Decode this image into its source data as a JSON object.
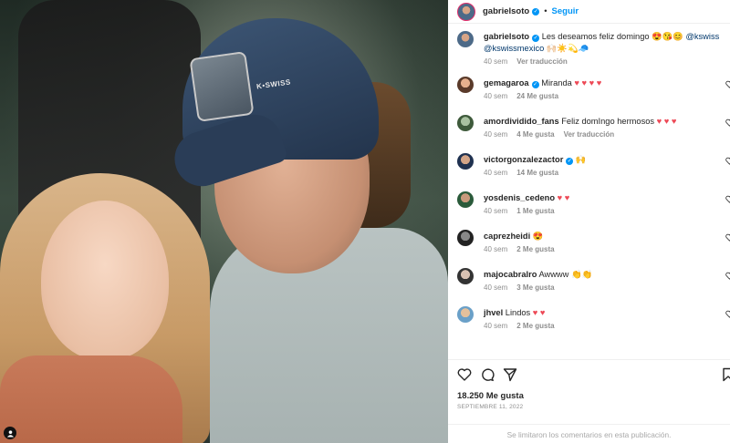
{
  "photo": {
    "brand_text": "K•SWISS"
  },
  "header": {
    "username": "gabrielsoto",
    "follow_label": "Seguir"
  },
  "caption": {
    "username": "gabrielsoto",
    "text_1": "Les deseamos feliz domingo 😍😘😊",
    "mention_1": "@kswiss",
    "mention_2": "@kswissmexico",
    "text_2": "🙌🏻☀️💫🧢",
    "time": "40 sem",
    "translate": "Ver traducción"
  },
  "comments": [
    {
      "username": "gemagaroa",
      "verified": true,
      "text": "Miranda",
      "hearts": "♥ ♥ ♥ ♥",
      "time": "40 sem",
      "likes": "24 Me gusta",
      "translate": ""
    },
    {
      "username": "amordividido_fans",
      "verified": false,
      "text": "Feliz domIngo hermosos",
      "hearts": "♥ ♥ ♥",
      "time": "40 sem",
      "likes": "4 Me gusta",
      "translate": "Ver traducción"
    },
    {
      "username": "victorgonzalezactor",
      "verified": true,
      "text": "🙌",
      "hearts": "",
      "time": "40 sem",
      "likes": "14 Me gusta",
      "translate": ""
    },
    {
      "username": "yosdenis_cedeno",
      "verified": false,
      "text": "",
      "hearts": "♥ ♥",
      "time": "40 sem",
      "likes": "1 Me gusta",
      "translate": ""
    },
    {
      "username": "caprezheidi",
      "verified": false,
      "text": "😍",
      "hearts": "",
      "time": "40 sem",
      "likes": "2 Me gusta",
      "translate": ""
    },
    {
      "username": "majocabralro",
      "verified": false,
      "text": "Awwww 👏👏",
      "hearts": "",
      "time": "40 sem",
      "likes": "3 Me gusta",
      "translate": ""
    },
    {
      "username": "jhvel",
      "verified": false,
      "text": "Lindos",
      "hearts": "♥ ♥",
      "time": "40 sem",
      "likes": "2 Me gusta",
      "translate": ""
    }
  ],
  "footer": {
    "likes": "18.250 Me gusta",
    "date": "SEPTIEMBRE 11, 2022",
    "limited": "Se limitaron los comentarios en esta publicación."
  },
  "colors": {
    "accent": "#0095f6",
    "heart": "#ed4956",
    "muted": "#8e8e8e"
  }
}
